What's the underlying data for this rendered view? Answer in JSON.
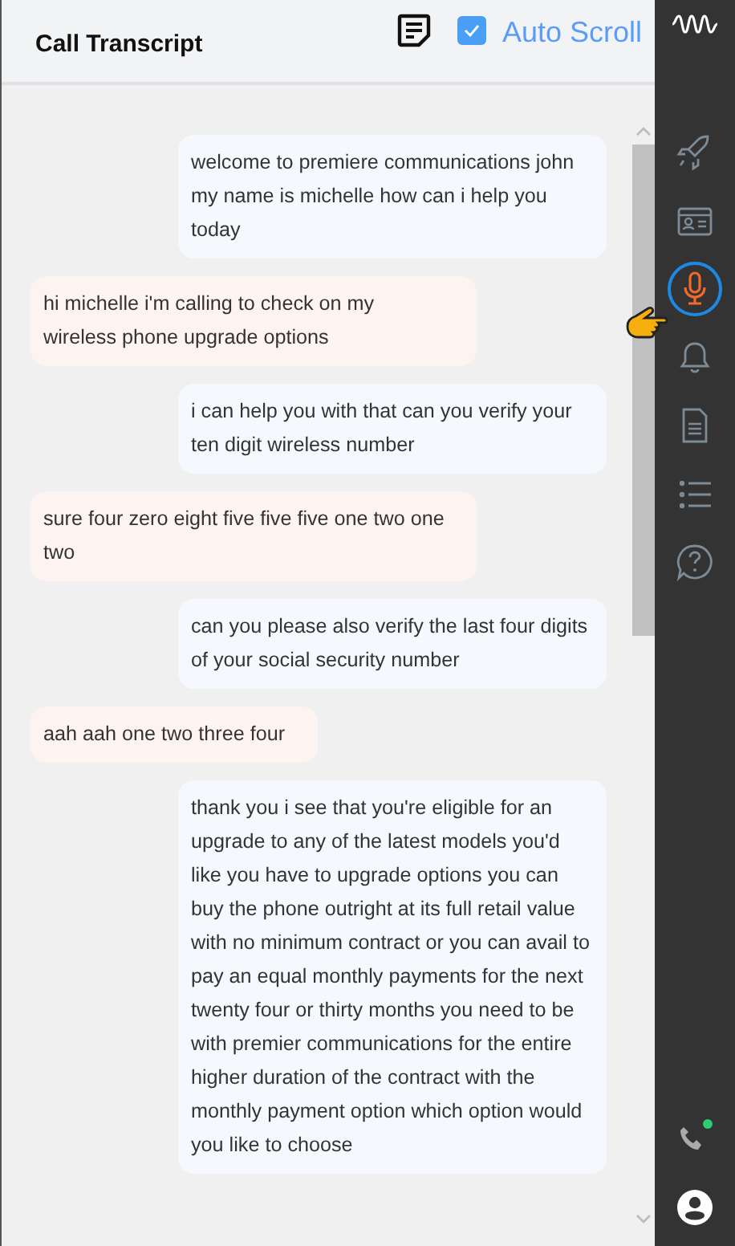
{
  "header": {
    "title": "Call Transcript",
    "auto_scroll": {
      "label": "Auto Scroll",
      "checked": true
    }
  },
  "messages": [
    {
      "kind": "agent",
      "text": "welcome to premiere communications john my name is michelle how can i help you today"
    },
    {
      "kind": "customer",
      "text": "hi michelle i'm calling to check on my wireless phone upgrade options"
    },
    {
      "kind": "agent",
      "text": "i can help you with that can you verify your ten digit wireless number"
    },
    {
      "kind": "customer",
      "text": "sure four zero eight five five five one two one two"
    },
    {
      "kind": "agent",
      "text": "can you please also verify the last four digits of your social security number"
    },
    {
      "kind": "customer",
      "text": "aah aah one two three four"
    },
    {
      "kind": "agent",
      "text": "thank you i see that you're eligible for an upgrade to any of the latest models you'd like you have to upgrade options you can buy the phone outright at its full retail value with no minimum contract or you can avail to pay an equal monthly payments for the next twenty four or thirty months you need to be with premier communications for the entire higher duration of the contract with the monthly payment option which option would you like to choose"
    }
  ],
  "sidebar": {
    "items": [
      {
        "selected": false
      },
      {
        "selected": false
      },
      {
        "selected": true
      },
      {
        "selected": false
      },
      {
        "selected": false
      },
      {
        "selected": false
      },
      {
        "selected": false
      }
    ],
    "phone": {
      "online": true
    }
  }
}
